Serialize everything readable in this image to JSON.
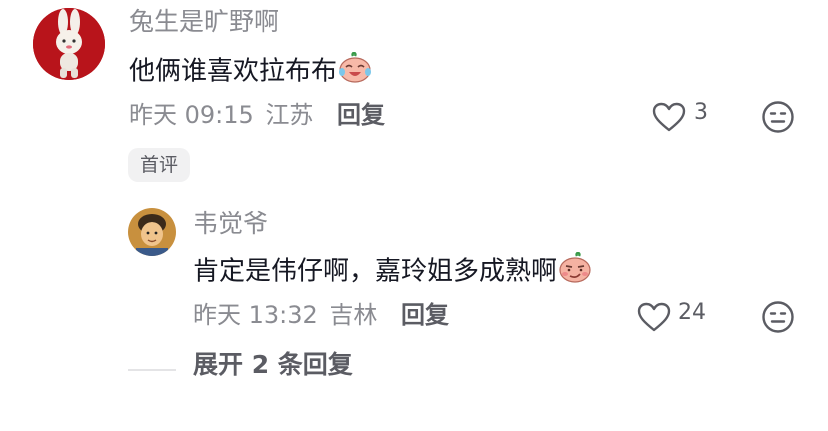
{
  "comment": {
    "username": "兔生是旷野啊",
    "text": "他俩谁喜欢拉布布",
    "emoji_icon": "crying-laugh-emoji-icon",
    "time": "昨天 09:15",
    "location": "江苏",
    "reply_label": "回复",
    "like_count": "3",
    "badge": "首评"
  },
  "reply": {
    "username": "韦觉爷",
    "text": "肯定是伟仔啊，嘉玲姐多成熟啊",
    "emoji_icon": "smirk-emoji-icon",
    "time": "昨天 13:32",
    "location": "吉林",
    "reply_label": "回复",
    "like_count": "24"
  },
  "expand_label": "展开 2 条回复",
  "colors": {
    "primary_text": "#161823",
    "secondary_text": "#8a8b91",
    "action_text": "#5b5c63",
    "avatar1_bg": "#b8141b"
  }
}
